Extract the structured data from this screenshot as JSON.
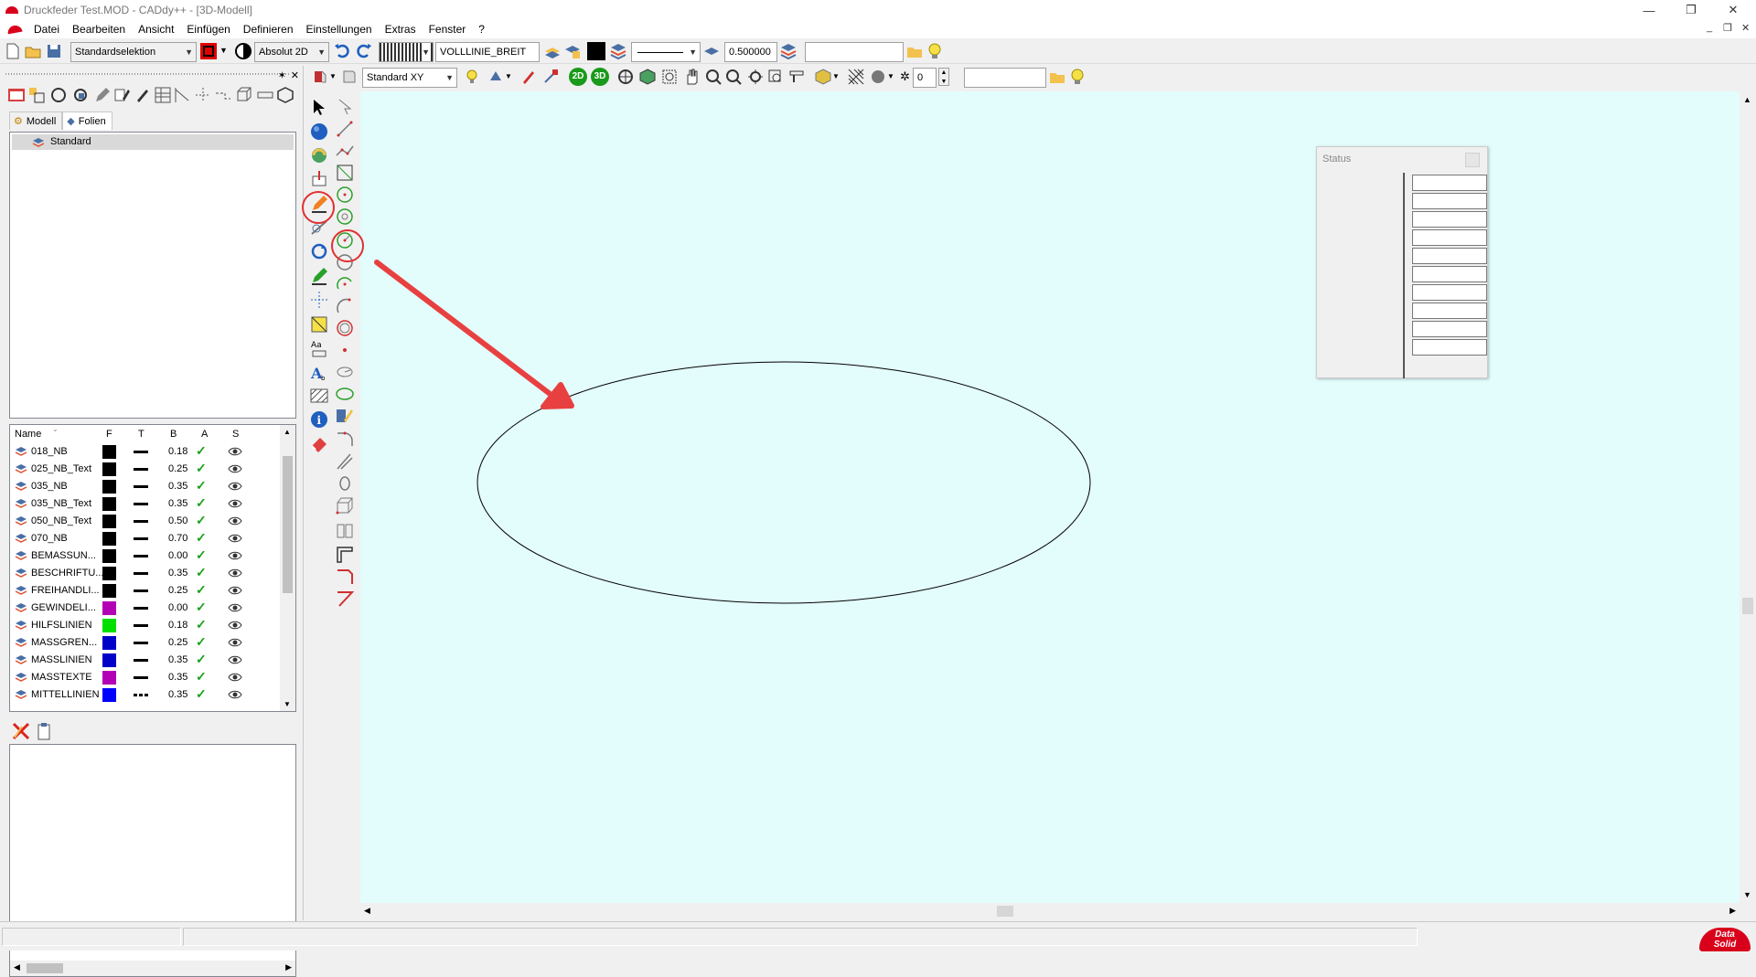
{
  "window": {
    "title": "Druckfeder Test.MOD  -  CADdy++ - [3D-Modell]",
    "minimize": "—",
    "restore": "❐",
    "close": "✕"
  },
  "menu": [
    "Datei",
    "Bearbeiten",
    "Ansicht",
    "Einfügen",
    "Definieren",
    "Einstellungen",
    "Extras",
    "Fenster",
    "?"
  ],
  "mdi": {
    "minimize": "_",
    "restore": "❐",
    "close": "✕"
  },
  "toolbar1": {
    "selection_mode": "Standardselektion",
    "coord_mode": "Absolut 2D",
    "line_style": "VOLLLINIE_BREIT",
    "line_width": "0.500000",
    "text_field": ""
  },
  "toolbar2": {
    "view_plane": "Standard XY",
    "btn_2d": "2D",
    "btn_3d": "3D",
    "number": "0",
    "text_field": ""
  },
  "leftpanel": {
    "close": "✕",
    "tabs": [
      {
        "label": "Modell"
      },
      {
        "label": "Folien"
      }
    ],
    "tree_items": [
      "Standard"
    ],
    "layer_columns": [
      "Name",
      "F",
      "T",
      "B",
      "A",
      "S"
    ],
    "layers": [
      {
        "name": "018_NB",
        "color": "#000000",
        "type": "solid",
        "width": "0.18"
      },
      {
        "name": "025_NB_Text",
        "color": "#000000",
        "type": "solid",
        "width": "0.25"
      },
      {
        "name": "035_NB",
        "color": "#000000",
        "type": "solid",
        "width": "0.35"
      },
      {
        "name": "035_NB_Text",
        "color": "#000000",
        "type": "solid",
        "width": "0.35"
      },
      {
        "name": "050_NB_Text",
        "color": "#000000",
        "type": "solid",
        "width": "0.50"
      },
      {
        "name": "070_NB",
        "color": "#000000",
        "type": "solid",
        "width": "0.70"
      },
      {
        "name": "BEMASSUN...",
        "color": "#000000",
        "type": "solid",
        "width": "0.00"
      },
      {
        "name": "BESCHRIFTU...",
        "color": "#000000",
        "type": "solid",
        "width": "0.35"
      },
      {
        "name": "FREIHANDLI...",
        "color": "#000000",
        "type": "solid",
        "width": "0.25"
      },
      {
        "name": "GEWINDELI...",
        "color": "#b400b4",
        "type": "solid",
        "width": "0.00"
      },
      {
        "name": "HILFSLINIEN",
        "color": "#00e000",
        "type": "solid",
        "width": "0.18"
      },
      {
        "name": "MASSGREN...",
        "color": "#0000c8",
        "type": "solid",
        "width": "0.25"
      },
      {
        "name": "MASSLINIEN",
        "color": "#0000c8",
        "type": "solid",
        "width": "0.35"
      },
      {
        "name": "MASSTEXTE",
        "color": "#b400b4",
        "type": "solid",
        "width": "0.35"
      },
      {
        "name": "MITTELLINIEN",
        "color": "#0000ff",
        "type": "dashdot",
        "width": "0.35"
      }
    ]
  },
  "status_window": {
    "title": "Status",
    "field_count": 10
  },
  "brand": {
    "line1": "Data",
    "line2": "Solid"
  },
  "colors": {
    "canvas": "#e3fcfc",
    "highlight": "#e03030",
    "arrow": "#e84040"
  }
}
